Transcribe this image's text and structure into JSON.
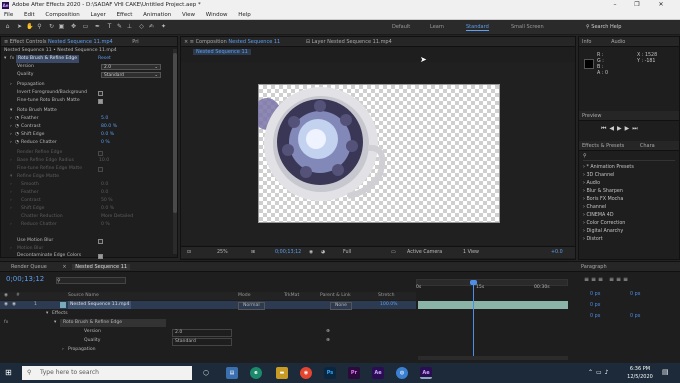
{
  "app": {
    "title": "Adobe After Effects 2020 - D:\\SADAF VHI CAKE\\Untitled Project.aep *",
    "logo": "Ae",
    "menu": [
      "File",
      "Edit",
      "Composition",
      "Layer",
      "Effect",
      "Animation",
      "View",
      "Window",
      "Help"
    ]
  },
  "workspaces": [
    "Default",
    "Learn",
    "Standard",
    "Small Screen"
  ],
  "active_workspace": "Standard",
  "search_help": "Search Help",
  "effect_controls": {
    "tab": "Effect Controls",
    "tab_layer": "Nested Sequence 11.mp4",
    "tab_right": "Pri",
    "header": "Nested Sequence 11 • Nested Sequence 11.mp4",
    "effect_name": "Roto Brush & Refine Edge",
    "reset": "Reset",
    "version_label": "Version",
    "version_value": "2.0",
    "quality_label": "Quality",
    "quality_value": "Standard",
    "propagation": "Propagation",
    "invert": "Invert Foreground/Background",
    "finetune": "Fine-tune Roto Brush Matte",
    "roto_matte": "Roto Brush Matte",
    "feather_label": "Feather",
    "feather_value": "5.0",
    "contrast_label": "Contrast",
    "contrast_value": "80.0 %",
    "shift_label": "Shift Edge",
    "shift_value": "0.0 %",
    "chatter_label": "Reduce Chatter",
    "chatter_value": "0 %",
    "render_refine": "Render Refine Edge",
    "base_refine": "Base Refine Edge Radius",
    "finetune_refine": "Fine-tune Refine Edge Matte",
    "refine_matte": "Refine Edge Matte",
    "smooth": "Smooth",
    "feather2": "Feather",
    "contrast2": "Contrast",
    "shift2": "Shift Edge",
    "chatter2": "Chatter Reduction",
    "reduce2": "Reduce Chatter",
    "v_smooth": "0.0",
    "v_feather": "0.0",
    "v_contrast": "50 %",
    "v_shift": "0.0 %",
    "v_chatter2": "More Detailed",
    "v_reduce2": "0 %",
    "motion_blur": "Use Motion Blur",
    "motion_blur2": "Motion Blur",
    "decontam": "Decontaminate Edge Colors"
  },
  "composition": {
    "tab": "Composition",
    "tab_name": "Nested Sequence 11",
    "layer_tab": "Layer  Nested Sequence 11.mp4",
    "subtab": "Nested Sequence 11",
    "zoom": "25%",
    "timecode": "0;00;13;12",
    "resolution": "Full",
    "camera": "Active Camera",
    "views": "1 View",
    "exposure": "+0.0"
  },
  "info_panel": {
    "tab": "Info",
    "tab2": "Audio",
    "r": "R :",
    "g": "G :",
    "b": "B :",
    "a": "A : 0",
    "x": "X : 1528",
    "y": "Y : -181"
  },
  "preview": {
    "tab": "Preview"
  },
  "effects_presets": {
    "tab": "Effects & Presets",
    "tab2": "Chara",
    "items": [
      "* Animation Presets",
      "3D Channel",
      "Audio",
      "Blur & Sharpen",
      "Boris FX Mocha",
      "Channel",
      "CINEMA 4D",
      "Color Correction",
      "Digital Anarchy",
      "Distort"
    ]
  },
  "paragraph": {
    "tab": "Paragraph",
    "vals": [
      "0 px",
      "0 px",
      "0 px",
      "0 px",
      "0 px"
    ]
  },
  "timeline": {
    "render_queue": "Render Queue",
    "comp_tab": "Nested Sequence 11",
    "timecode": "0;00;13;12",
    "col_source": "Source Name",
    "col_mode": "Mode",
    "col_trkmat": "TrkMat",
    "col_parent": "Parent & Link",
    "col_stretch": "Stretch",
    "layer_num": "1",
    "layer_name": "Nested Sequence 11.mp4",
    "layer_mode": "Normal",
    "layer_parent": "None",
    "layer_stretch": "100.0%",
    "effects": "Effects",
    "effect": "Roto Brush & Refine Edge",
    "version": "Version",
    "version_v": "2.0",
    "quality": "Quality",
    "quality_v": "Standard",
    "propagation": "Propagation",
    "ruler": [
      "0s",
      "15s",
      "00:30s"
    ]
  },
  "taskbar": {
    "search": "Type here to search",
    "time": "6:36 PM",
    "date": "12/5/2020",
    "apps": [
      "Ps",
      "Pr",
      "Ae"
    ]
  }
}
